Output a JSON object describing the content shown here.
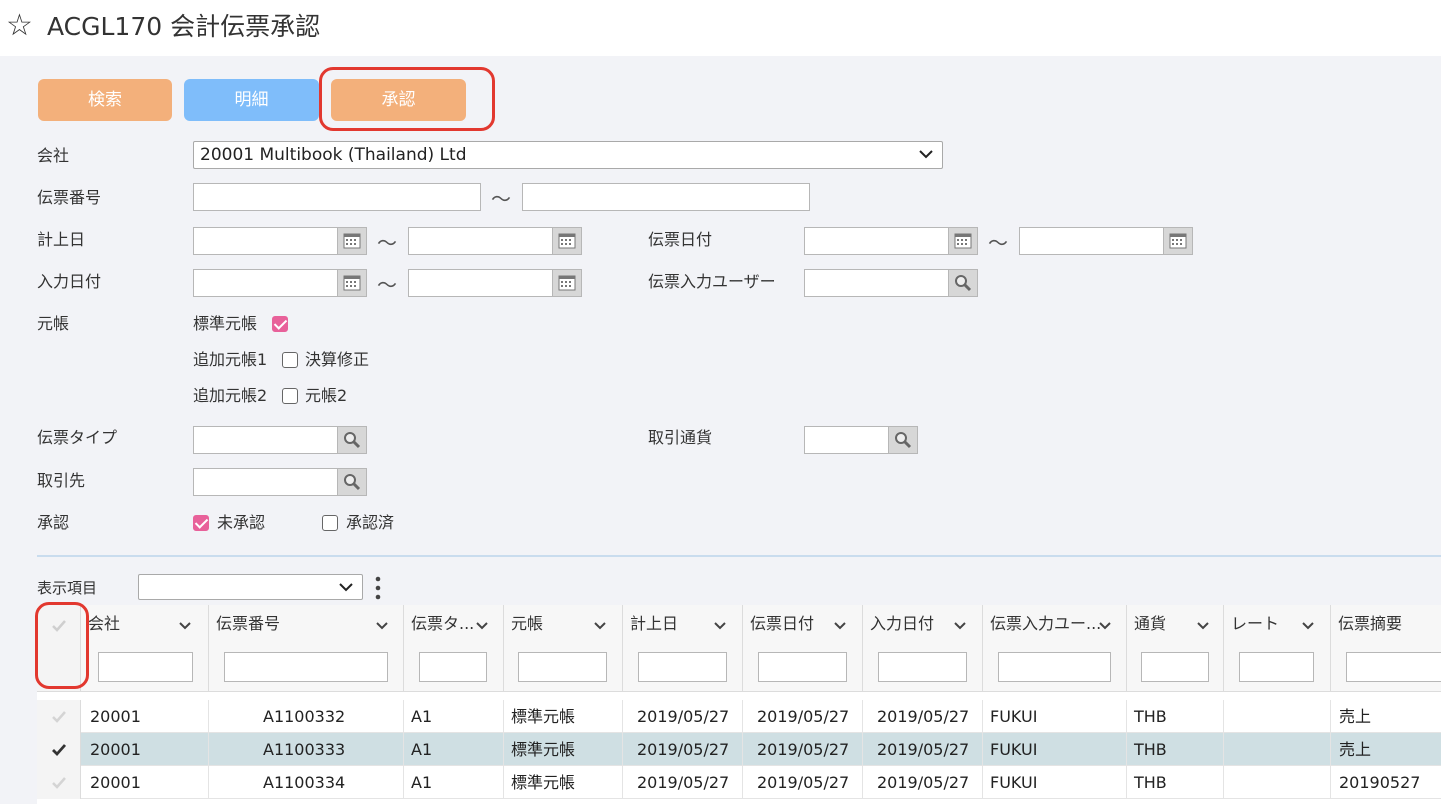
{
  "header": {
    "star_icon": "star-outline-icon",
    "title": "ACGL170 会計伝票承認"
  },
  "toolbar": {
    "search_label": "検索",
    "detail_label": "明細",
    "approve_label": "承認"
  },
  "form": {
    "company_label": "会社",
    "company_value": "20001 Multibook (Thailand) Ltd",
    "slip_no_label": "伝票番号",
    "posting_date_label": "計上日",
    "slip_date_label": "伝票日付",
    "input_date_label": "入力日付",
    "slip_input_user_label": "伝票入力ユーザー",
    "ledger_label": "元帳",
    "ledger_standard": "標準元帳",
    "ledger_add1": "追加元帳1",
    "ledger_closing": "決算修正",
    "ledger_add2": "追加元帳2",
    "ledger_2": "元帳2",
    "slip_type_label": "伝票タイプ",
    "trade_currency_label": "取引通貨",
    "partner_label": "取引先",
    "approval_label": "承認",
    "unapproved_label": "未承認",
    "approved_label": "承認済",
    "tilde": "〜"
  },
  "grid": {
    "display_items_label": "表示項目",
    "columns": [
      "会社",
      "伝票番号",
      "伝票タ...",
      "元帳",
      "計上日",
      "伝票日付",
      "入力日付",
      "伝票入力ユー...",
      "通貨",
      "レート",
      "伝票摘要"
    ],
    "rows": [
      {
        "selected": false,
        "cells": [
          "20001",
          "A1100332",
          "A1",
          "標準元帳",
          "2019/05/27",
          "2019/05/27",
          "2019/05/27",
          "FUKUI",
          "THB",
          "",
          "売上"
        ]
      },
      {
        "selected": true,
        "cells": [
          "20001",
          "A1100333",
          "A1",
          "標準元帳",
          "2019/05/27",
          "2019/05/27",
          "2019/05/27",
          "FUKUI",
          "THB",
          "",
          "売上"
        ]
      },
      {
        "selected": false,
        "cells": [
          "20001",
          "A1100334",
          "A1",
          "標準元帳",
          "2019/05/27",
          "2019/05/27",
          "2019/05/27",
          "FUKUI",
          "THB",
          "",
          "20190527"
        ]
      }
    ]
  },
  "colors": {
    "accent_orange": "#f3b07b",
    "accent_blue": "#7fbdfa",
    "highlight_red": "#e2382f",
    "check_pink": "#e8619a"
  }
}
